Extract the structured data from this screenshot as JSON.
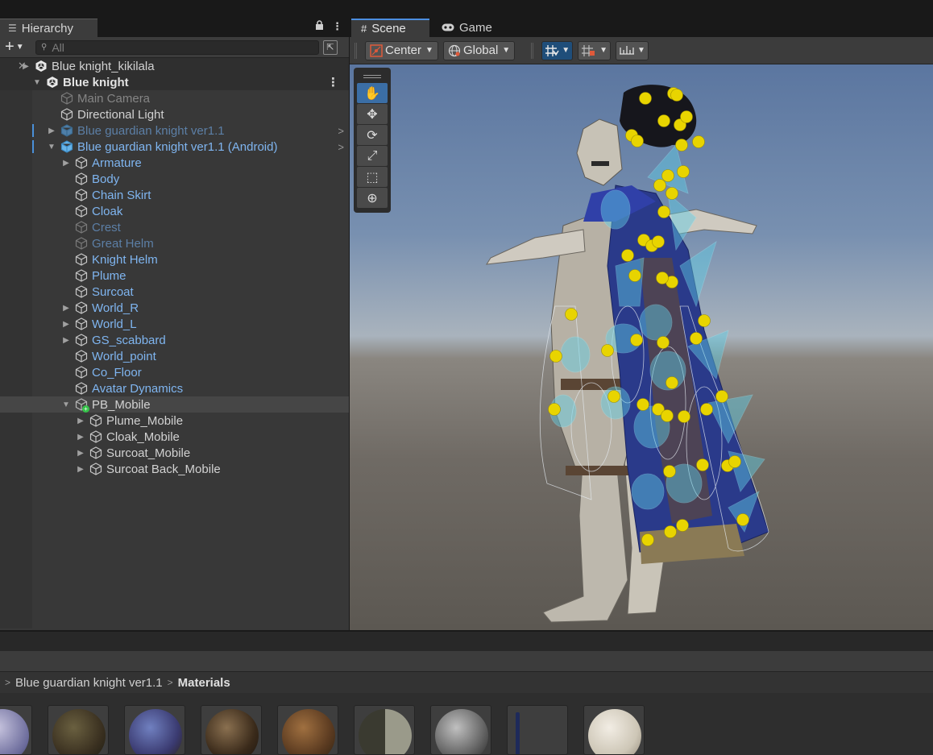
{
  "hierarchy": {
    "tab_label": "Hierarchy",
    "search_placeholder": "All",
    "rows": [
      {
        "label": "Blue knight_kikilala",
        "depth": 0,
        "type": "scene",
        "arrow": "right"
      },
      {
        "label": "Blue knight",
        "depth": 1,
        "type": "scene-bold",
        "arrow": "down"
      },
      {
        "label": "Main Camera",
        "depth": 2,
        "type": "dim"
      },
      {
        "label": "Directional Light",
        "depth": 2,
        "type": "normal"
      },
      {
        "label": "Blue guardian knight ver1.1",
        "depth": 2,
        "type": "prefab-dim",
        "arrow": "right"
      },
      {
        "label": "Blue guardian knight ver1.1 (Android)",
        "depth": 2,
        "type": "prefab",
        "arrow": "down"
      },
      {
        "label": "Armature",
        "depth": 3,
        "type": "prefab",
        "arrow": "right"
      },
      {
        "label": "Body",
        "depth": 3,
        "type": "prefab"
      },
      {
        "label": "Chain Skirt",
        "depth": 3,
        "type": "prefab"
      },
      {
        "label": "Cloak",
        "depth": 3,
        "type": "prefab"
      },
      {
        "label": "Crest",
        "depth": 3,
        "type": "prefab-dim"
      },
      {
        "label": "Great Helm",
        "depth": 3,
        "type": "prefab-dim"
      },
      {
        "label": "Knight Helm",
        "depth": 3,
        "type": "prefab"
      },
      {
        "label": "Plume",
        "depth": 3,
        "type": "prefab"
      },
      {
        "label": "Surcoat",
        "depth": 3,
        "type": "prefab"
      },
      {
        "label": "World_R",
        "depth": 3,
        "type": "prefab",
        "arrow": "right"
      },
      {
        "label": "World_L",
        "depth": 3,
        "type": "prefab",
        "arrow": "right"
      },
      {
        "label": "GS_scabbard",
        "depth": 3,
        "type": "prefab",
        "arrow": "right"
      },
      {
        "label": "World_point",
        "depth": 3,
        "type": "prefab"
      },
      {
        "label": "Co_Floor",
        "depth": 3,
        "type": "prefab"
      },
      {
        "label": "Avatar Dynamics",
        "depth": 3,
        "type": "prefab"
      },
      {
        "label": "PB_Mobile",
        "depth": 3,
        "type": "normal",
        "arrow": "down",
        "selected": true
      },
      {
        "label": "Plume_Mobile",
        "depth": 4,
        "type": "normal",
        "arrow": "right"
      },
      {
        "label": "Cloak_Mobile",
        "depth": 4,
        "type": "normal",
        "arrow": "right"
      },
      {
        "label": "Surcoat_Mobile",
        "depth": 4,
        "type": "normal",
        "arrow": "right"
      },
      {
        "label": "Surcoat Back_Mobile",
        "depth": 4,
        "type": "normal",
        "arrow": "right"
      }
    ]
  },
  "scene": {
    "tab_scene": "Scene",
    "tab_game": "Game",
    "pivot_label": "Center",
    "space_label": "Global"
  },
  "project": {
    "breadcrumb_root": "Blue guardian knight ver1.1",
    "breadcrumb_current": "Materials"
  },
  "colors": {
    "accent": "#4c8ee0",
    "prefab_text": "#7fb5f0",
    "gizmo_yellow": "#e8d400",
    "collider_cyan": "#5fd0e8"
  }
}
